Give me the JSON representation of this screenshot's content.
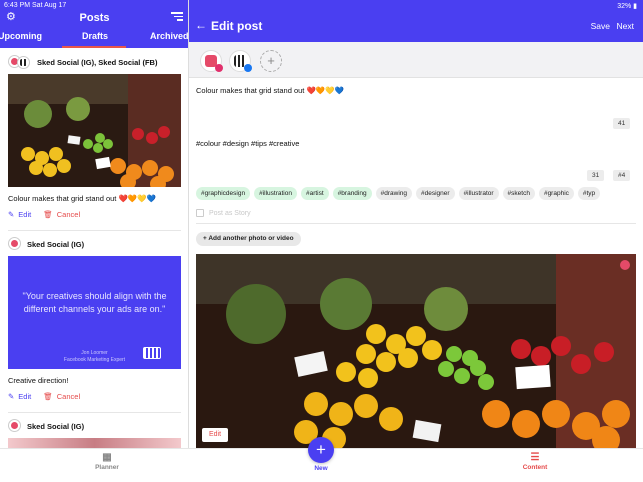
{
  "left_panel": {
    "status_time": "6:43 PM   Sat Aug 17",
    "title": "Posts",
    "gear_icon": "gear-icon",
    "filter_icon": "filter-icon",
    "tabs": [
      {
        "label": "Upcoming"
      },
      {
        "label": "Drafts",
        "active": true
      },
      {
        "label": "Archived"
      }
    ],
    "posts": [
      {
        "account": "Sked Social (IG), Sked Social (FB)",
        "caption": "Colour makes that grid stand out ❤️🧡💛💙",
        "edit_label": "Edit",
        "cancel_label": "Cancel"
      },
      {
        "account": "Sked Social (IG)",
        "quote": "\"Your creatives should align with the different channels your ads are on.\"",
        "quote_author": "Jon Loomer",
        "quote_role": "Facebook Marketing Expert",
        "caption": "Creative direction!",
        "edit_label": "Edit",
        "cancel_label": "Cancel"
      },
      {
        "account": "Sked Social (IG)"
      }
    ]
  },
  "right_panel": {
    "status": "32% ▮",
    "title": "Edit post",
    "save_label": "Save",
    "next_label": "Next",
    "add_account": "+",
    "caption": "Colour makes that grid stand out ❤️🧡💛💙",
    "caption_count": "41",
    "hashtags_text": "#colour #design #tips #creative",
    "hashtag_count": "31",
    "hashtag_tags_count": "#4",
    "suggested_tags": [
      {
        "label": "#graphicdesign",
        "selected": true
      },
      {
        "label": "#illustration",
        "selected": true
      },
      {
        "label": "#artist",
        "selected": true
      },
      {
        "label": "#branding",
        "selected": true
      },
      {
        "label": "#drawing",
        "selected": false
      },
      {
        "label": "#designer",
        "selected": false
      },
      {
        "label": "#illustrator",
        "selected": false
      },
      {
        "label": "#sketch",
        "selected": false
      },
      {
        "label": "#graphic",
        "selected": false
      },
      {
        "label": "#typ",
        "selected": false
      }
    ],
    "story_label": "Post as Story",
    "add_media_label": "+ Add another photo or video",
    "image_edit_label": "Edit"
  },
  "bottom_nav": {
    "planner_label": "Planner",
    "new_label": "New",
    "content_label": "Content"
  },
  "colors": {
    "brand": "#4a3ff1",
    "accent": "#e54a4a",
    "tag_selected": "#d7f5e0"
  }
}
